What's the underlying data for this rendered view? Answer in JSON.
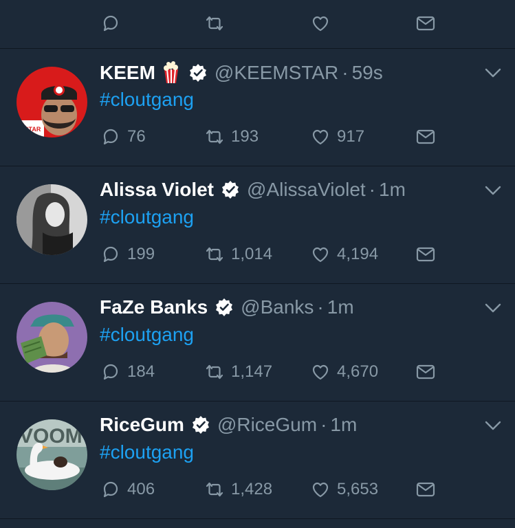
{
  "top_actions": {
    "reply_count": "",
    "retweet_count": "",
    "like_count": ""
  },
  "tweets": [
    {
      "name": "KEEM",
      "has_emoji": true,
      "emoji": "popcorn-icon",
      "handle": "@KEEMSTAR",
      "separator": "·",
      "time": "59s",
      "text": "#cloutgang",
      "replies": "76",
      "retweets": "193",
      "likes": "917",
      "avatar_colors": [
        "#d81b1b",
        "#1a1a1a"
      ]
    },
    {
      "name": "Alissa Violet",
      "has_emoji": false,
      "handle": "@AlissaViolet",
      "separator": "·",
      "time": "1m",
      "text": "#cloutgang",
      "replies": "199",
      "retweets": "1,014",
      "likes": "4,194",
      "avatar_colors": [
        "#cfcfcf",
        "#2a2a2a"
      ]
    },
    {
      "name": "FaZe Banks",
      "has_emoji": false,
      "handle": "@Banks",
      "separator": "·",
      "time": "1m",
      "text": "#cloutgang",
      "replies": "184",
      "retweets": "1,147",
      "likes": "4,670",
      "avatar_colors": [
        "#8e6fb0",
        "#c89a76"
      ]
    },
    {
      "name": "RiceGum",
      "has_emoji": false,
      "handle": "@RiceGum",
      "separator": "·",
      "time": "1m",
      "text": "#cloutgang",
      "replies": "406",
      "retweets": "1,428",
      "likes": "5,653",
      "avatar_colors": [
        "#9bb4b0",
        "#f2f2f2"
      ]
    }
  ],
  "colors": {
    "background": "#1c2938",
    "divider": "#0f1721",
    "muted": "#8899a6",
    "link": "#1da1f2",
    "verified": "#ffffff"
  }
}
